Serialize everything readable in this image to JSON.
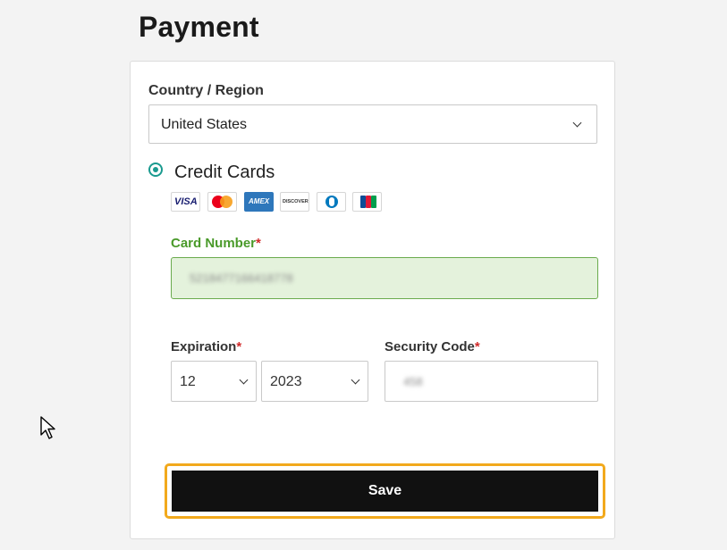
{
  "page": {
    "title": "Payment"
  },
  "country": {
    "label": "Country / Region",
    "value": "United States"
  },
  "payment_method": {
    "label": "Credit Cards",
    "selected": true,
    "card_logos": [
      {
        "name": "visa",
        "text": "VISA"
      },
      {
        "name": "mastercard",
        "text": ""
      },
      {
        "name": "amex",
        "text": "AMEX"
      },
      {
        "name": "discover",
        "text": "DISCOVER"
      },
      {
        "name": "diners",
        "text": ""
      },
      {
        "name": "jcb",
        "text": ""
      }
    ]
  },
  "card_number": {
    "label": "Card Number",
    "required_mark": "*",
    "value": "5218477166418778"
  },
  "expiration": {
    "label": "Expiration",
    "required_mark": "*",
    "month": "12",
    "year": "2023"
  },
  "security_code": {
    "label": "Security Code",
    "required_mark": "*",
    "value": "458"
  },
  "save": {
    "label": "Save"
  },
  "colors": {
    "accent_radio": "#1a9a8f",
    "valid_green": "#4a9a2a",
    "valid_bg": "#e4f2dc",
    "required_red": "#d12b2b",
    "save_bg": "#111111",
    "focus_ring": "#f2a91c"
  }
}
